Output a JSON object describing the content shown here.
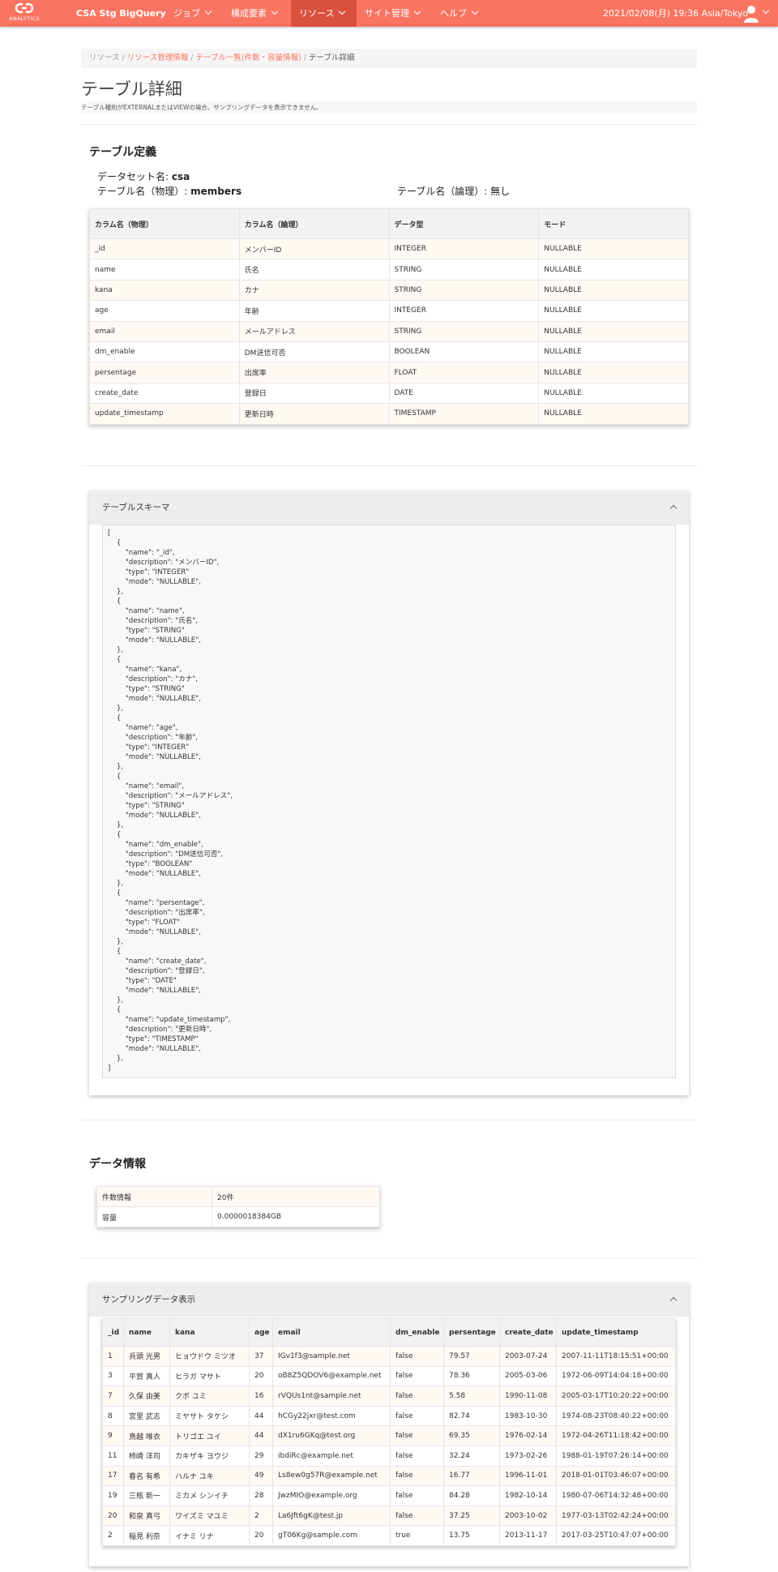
{
  "nav": {
    "logo_text": "ANALYTICS",
    "brand": "CSA Stg BigQuery",
    "items": [
      {
        "label": "ジョブ"
      },
      {
        "label": "構成要素"
      },
      {
        "label": "リソース"
      },
      {
        "label": "サイト管理"
      },
      {
        "label": "ヘルプ"
      }
    ],
    "datetime": "2021/02/08(月) 19:36 Asia/Tokyo",
    "accent_color": "#f97461",
    "active_color": "#d9503f"
  },
  "breadcrumb": {
    "items": [
      "リソース",
      "リソース管理情報",
      "テーブル一覧(件数・容量情報)"
    ],
    "current": "テーブル詳細",
    "separator": "/"
  },
  "page": {
    "title": "テーブル詳細",
    "note": "テーブル種別がEXTERNALまたはVIEWの場合、サンプリングデータを表示できません。"
  },
  "definition": {
    "title": "テーブル定義",
    "dataset_label": "データセット名:",
    "dataset_value": "csa",
    "physical_label": "テーブル名（物理）:",
    "physical_value": "members",
    "logical_label": "テーブル名（論理）:",
    "logical_value": "無し",
    "columns": [
      "カラム名（物理）",
      "カラム名（論理）",
      "データ型",
      "モード"
    ],
    "rows": [
      [
        "_id",
        "メンバーID",
        "INTEGER",
        "NULLABLE"
      ],
      [
        "name",
        "氏名",
        "STRING",
        "NULLABLE"
      ],
      [
        "kana",
        "カナ",
        "STRING",
        "NULLABLE"
      ],
      [
        "age",
        "年齢",
        "INTEGER",
        "NULLABLE"
      ],
      [
        "email",
        "メールアドレス",
        "STRING",
        "NULLABLE"
      ],
      [
        "dm_enable",
        "DM送信可否",
        "BOOLEAN",
        "NULLABLE"
      ],
      [
        "persentage",
        "出席率",
        "FLOAT",
        "NULLABLE"
      ],
      [
        "create_date",
        "登録日",
        "DATE",
        "NULLABLE"
      ],
      [
        "update_timestamp",
        "更新日時",
        "TIMESTAMP",
        "NULLABLE"
      ]
    ]
  },
  "schema_panel": {
    "title": "テーブルスキーマ",
    "text": "[\n    {\n        \"name\": \"_id\",\n        \"description\": \"メンバーID\",\n        \"type\": \"INTEGER\"\n        \"mode\": \"NULLABLE\",\n    },\n    {\n        \"name\": \"name\",\n        \"description\": \"氏名\",\n        \"type\": \"STRING\"\n        \"mode\": \"NULLABLE\",\n    },\n    {\n        \"name\": \"kana\",\n        \"description\": \"カナ\",\n        \"type\": \"STRING\"\n        \"mode\": \"NULLABLE\",\n    },\n    {\n        \"name\": \"age\",\n        \"description\": \"年齢\",\n        \"type\": \"INTEGER\"\n        \"mode\": \"NULLABLE\",\n    },\n    {\n        \"name\": \"email\",\n        \"description\": \"メールアドレス\",\n        \"type\": \"STRING\"\n        \"mode\": \"NULLABLE\",\n    },\n    {\n        \"name\": \"dm_enable\",\n        \"description\": \"DM送信可否\",\n        \"type\": \"BOOLEAN\"\n        \"mode\": \"NULLABLE\",\n    },\n    {\n        \"name\": \"persentage\",\n        \"description\": \"出席率\",\n        \"type\": \"FLOAT\"\n        \"mode\": \"NULLABLE\",\n    },\n    {\n        \"name\": \"create_date\",\n        \"description\": \"登録日\",\n        \"type\": \"DATE\"\n        \"mode\": \"NULLABLE\",\n    },\n    {\n        \"name\": \"update_timestamp\",\n        \"description\": \"更新日時\",\n        \"type\": \"TIMESTAMP\"\n        \"mode\": \"NULLABLE\",\n    },\n]"
  },
  "data_info": {
    "title": "データ情報",
    "rows": [
      [
        "件数情報",
        "20件"
      ],
      [
        "容量",
        "0.0000018384GB"
      ]
    ]
  },
  "sampling": {
    "title": "サンプリングデータ表示",
    "columns": [
      "_id",
      "name",
      "kana",
      "age",
      "email",
      "dm_enable",
      "persentage",
      "create_date",
      "update_timestamp"
    ],
    "rows": [
      [
        "1",
        "兵頭 光男",
        "ヒョウドウ ミツオ",
        "37",
        "IGv1f3@sample.net",
        "false",
        "79.57",
        "2003-07-24",
        "2007-11-11T18:15:51+00:00"
      ],
      [
        "3",
        "平賀 真人",
        "ヒラガ マサト",
        "20",
        "oB8Z5QDOV6@example.net",
        "false",
        "78.36",
        "2005-03-06",
        "1972-06-09T14:04:18+00:00"
      ],
      [
        "7",
        "久保 由美",
        "クボ ユミ",
        "16",
        "rVQUs1nt@sample.net",
        "false",
        "5.58",
        "1990-11-08",
        "2005-03-17T10:20:22+00:00"
      ],
      [
        "8",
        "宮里 武志",
        "ミヤサト タケシ",
        "44",
        "hCGy22jxr@test.com",
        "false",
        "82.74",
        "1983-10-30",
        "1974-08-23T08:40:22+00:00"
      ],
      [
        "9",
        "鳥越 唯衣",
        "トリゴエ ユイ",
        "44",
        "dX1ru6GKq@test.org",
        "false",
        "69.35",
        "1976-02-14",
        "1972-04-26T11:18:42+00:00"
      ],
      [
        "11",
        "柿崎 洋司",
        "カキザキ ヨウジ",
        "29",
        "ibdiRc@example.net",
        "false",
        "32.24",
        "1973-02-26",
        "1988-01-19T07:26:14+00:00"
      ],
      [
        "17",
        "春名 有希",
        "ハルナ ユキ",
        "49",
        "Ls8ew0g57R@example.net",
        "false",
        "16.77",
        "1996-11-01",
        "2018-01-01T03:46:07+00:00"
      ],
      [
        "19",
        "三瓶 新一",
        "ミカメ シンイチ",
        "28",
        "JwzMIO@example.org",
        "false",
        "84.28",
        "1982-10-14",
        "1980-07-06T14:32:48+00:00"
      ],
      [
        "20",
        "和泉 真弓",
        "ワイズミ マユミ",
        "2",
        "La6Jft6gK@test.jp",
        "false",
        "37.25",
        "2003-10-02",
        "1977-03-13T02:42:24+00:00"
      ],
      [
        "2",
        "稲見 利奈",
        "イナミ リナ",
        "20",
        "gT06Kg@sample.com",
        "true",
        "13.75",
        "2013-11-17",
        "2017-03-25T10:47:07+00:00"
      ]
    ]
  }
}
